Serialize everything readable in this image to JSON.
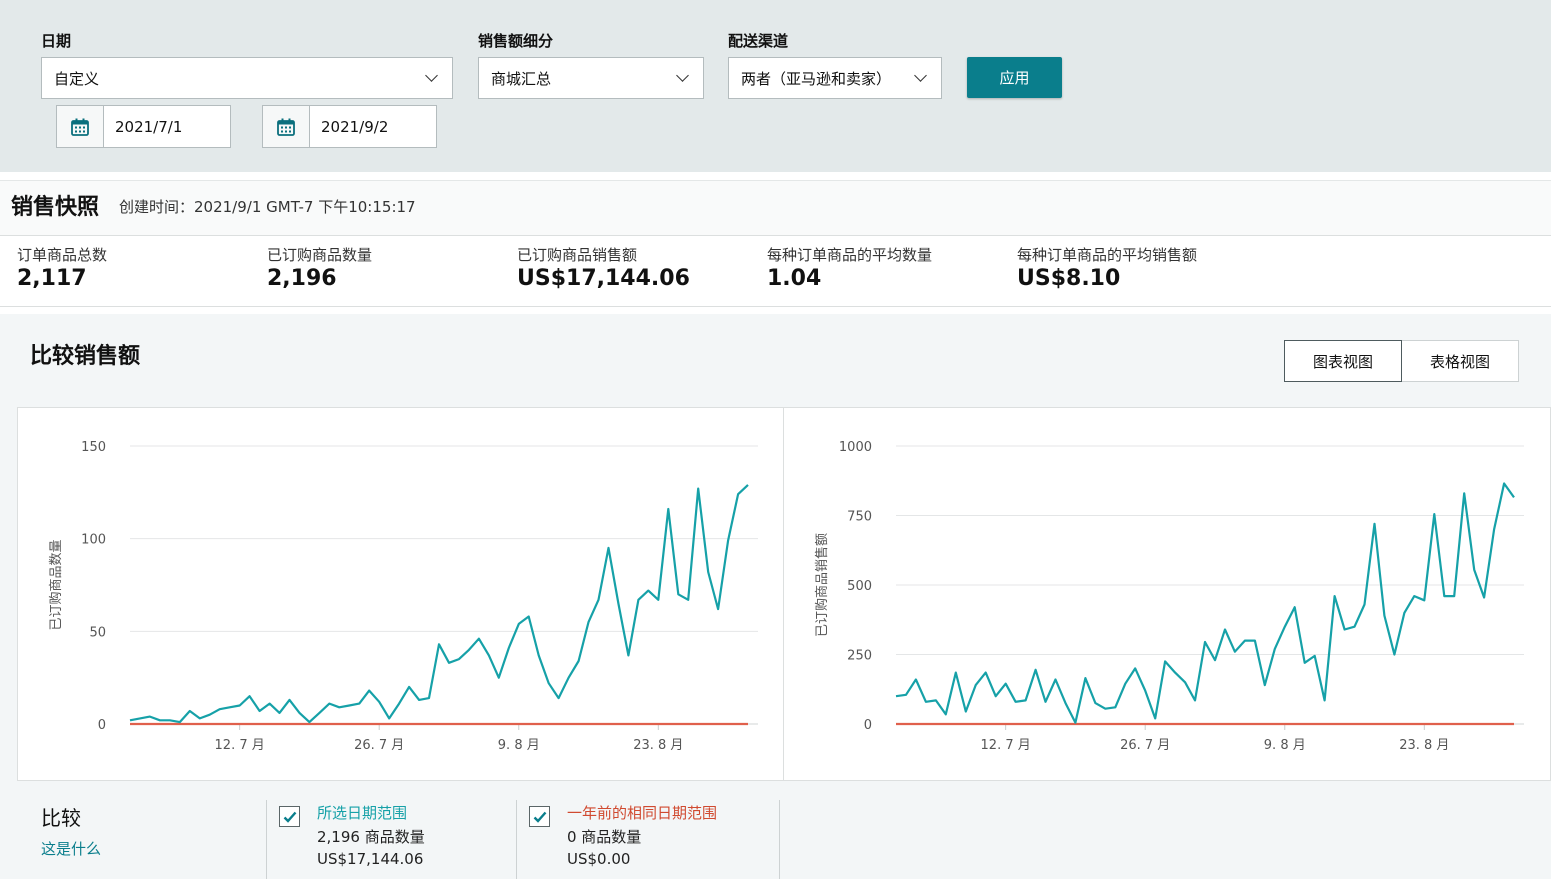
{
  "filters": {
    "date": {
      "label": "日期",
      "value": "自定义",
      "start": "2021/7/1",
      "end": "2021/9/2"
    },
    "sales_breakdown": {
      "label": "销售额细分",
      "value": "商城汇总"
    },
    "fulfillment": {
      "label": "配送渠道",
      "value": "两者（亚马逊和卖家）"
    },
    "apply_label": "应用"
  },
  "snapshot": {
    "title": "销售快照",
    "created": "创建时间：2021/9/1 GMT-7 下午10:15:17",
    "metrics": [
      {
        "label": "订单商品总数",
        "value": "2,117"
      },
      {
        "label": "已订购商品数量",
        "value": "2,196"
      },
      {
        "label": "已订购商品销售额",
        "value": "US$17,144.06"
      },
      {
        "label": "每种订单商品的平均数量",
        "value": "1.04"
      },
      {
        "label": "每种订单商品的平均销售额",
        "value": "US$8.10"
      }
    ]
  },
  "compare": {
    "title": "比较销售额",
    "view_chart": "图表视图",
    "view_table": "表格视图"
  },
  "colors": {
    "current": "#16a1a8",
    "last_year": "#e0604c",
    "accent": "#0a7e8c"
  },
  "chart_data": [
    {
      "type": "line",
      "ylabel": "已订购商品数量",
      "ylim": [
        0,
        150
      ],
      "yticks": [
        0,
        50,
        100,
        150
      ],
      "x_start": "2021-07-01",
      "x_end": "2021-09-02",
      "xticks": [
        {
          "date": "2021-07-12",
          "label": "12. 7 月"
        },
        {
          "date": "2021-07-26",
          "label": "26. 7 月"
        },
        {
          "date": "2021-08-09",
          "label": "9. 8 月"
        },
        {
          "date": "2021-08-23",
          "label": "23. 8 月"
        }
      ],
      "series": [
        {
          "name": "所选日期范围",
          "values": [
            2,
            3,
            4,
            2,
            2,
            1,
            7,
            3,
            5,
            8,
            9,
            10,
            15,
            7,
            11,
            6,
            13,
            6,
            1,
            6,
            11,
            9,
            10,
            11,
            18,
            12,
            3,
            11,
            20,
            13,
            14,
            43,
            33,
            35,
            40,
            46,
            37,
            25,
            41,
            54,
            58,
            37,
            22,
            14,
            25,
            34,
            55,
            67,
            95,
            65,
            37,
            67,
            72,
            67,
            116,
            70,
            67,
            127,
            82,
            62,
            99,
            124,
            129
          ]
        },
        {
          "name": "一年前的相同日期范围",
          "values": [
            0,
            0,
            0,
            0,
            0,
            0,
            0,
            0,
            0,
            0,
            0,
            0,
            0,
            0,
            0,
            0,
            0,
            0,
            0,
            0,
            0,
            0,
            0,
            0,
            0,
            0,
            0,
            0,
            0,
            0,
            0,
            0,
            0,
            0,
            0,
            0,
            0,
            0,
            0,
            0,
            0,
            0,
            0,
            0,
            0,
            0,
            0,
            0,
            0,
            0,
            0,
            0,
            0,
            0,
            0,
            0,
            0,
            0,
            0,
            0,
            0,
            0,
            0
          ]
        }
      ]
    },
    {
      "type": "line",
      "ylabel": "已订购商品销售额",
      "ylim": [
        0,
        1000
      ],
      "yticks": [
        0,
        250,
        500,
        750,
        1000
      ],
      "x_start": "2021-07-01",
      "x_end": "2021-09-02",
      "xticks": [
        {
          "date": "2021-07-12",
          "label": "12. 7 月"
        },
        {
          "date": "2021-07-26",
          "label": "26. 7 月"
        },
        {
          "date": "2021-08-09",
          "label": "9. 8 月"
        },
        {
          "date": "2021-08-23",
          "label": "23. 8 月"
        }
      ],
      "series": [
        {
          "name": "所选日期范围",
          "values": [
            100,
            105,
            160,
            80,
            85,
            35,
            185,
            45,
            140,
            185,
            100,
            145,
            80,
            85,
            195,
            80,
            160,
            75,
            5,
            165,
            75,
            55,
            60,
            145,
            200,
            120,
            20,
            225,
            185,
            150,
            85,
            295,
            230,
            340,
            260,
            300,
            300,
            140,
            270,
            350,
            420,
            220,
            245,
            85,
            460,
            340,
            350,
            430,
            720,
            390,
            250,
            400,
            460,
            445,
            755,
            460,
            460,
            830,
            555,
            455,
            700,
            865,
            815
          ]
        },
        {
          "name": "一年前的相同日期范围",
          "values": [
            0,
            0,
            0,
            0,
            0,
            0,
            0,
            0,
            0,
            0,
            0,
            0,
            0,
            0,
            0,
            0,
            0,
            0,
            0,
            0,
            0,
            0,
            0,
            0,
            0,
            0,
            0,
            0,
            0,
            0,
            0,
            0,
            0,
            0,
            0,
            0,
            0,
            0,
            0,
            0,
            0,
            0,
            0,
            0,
            0,
            0,
            0,
            0,
            0,
            0,
            0,
            0,
            0,
            0,
            0,
            0,
            0,
            0,
            0,
            0,
            0,
            0,
            0
          ]
        }
      ]
    }
  ],
  "legend": {
    "title": "比较",
    "help_link": "这是什么",
    "items": [
      {
        "name": "所选日期范围",
        "qty": "2,196 商品数量",
        "sales": "US$17,144.06"
      },
      {
        "name": "一年前的相同日期范围",
        "qty": "0 商品数量",
        "sales": "US$0.00"
      }
    ]
  }
}
